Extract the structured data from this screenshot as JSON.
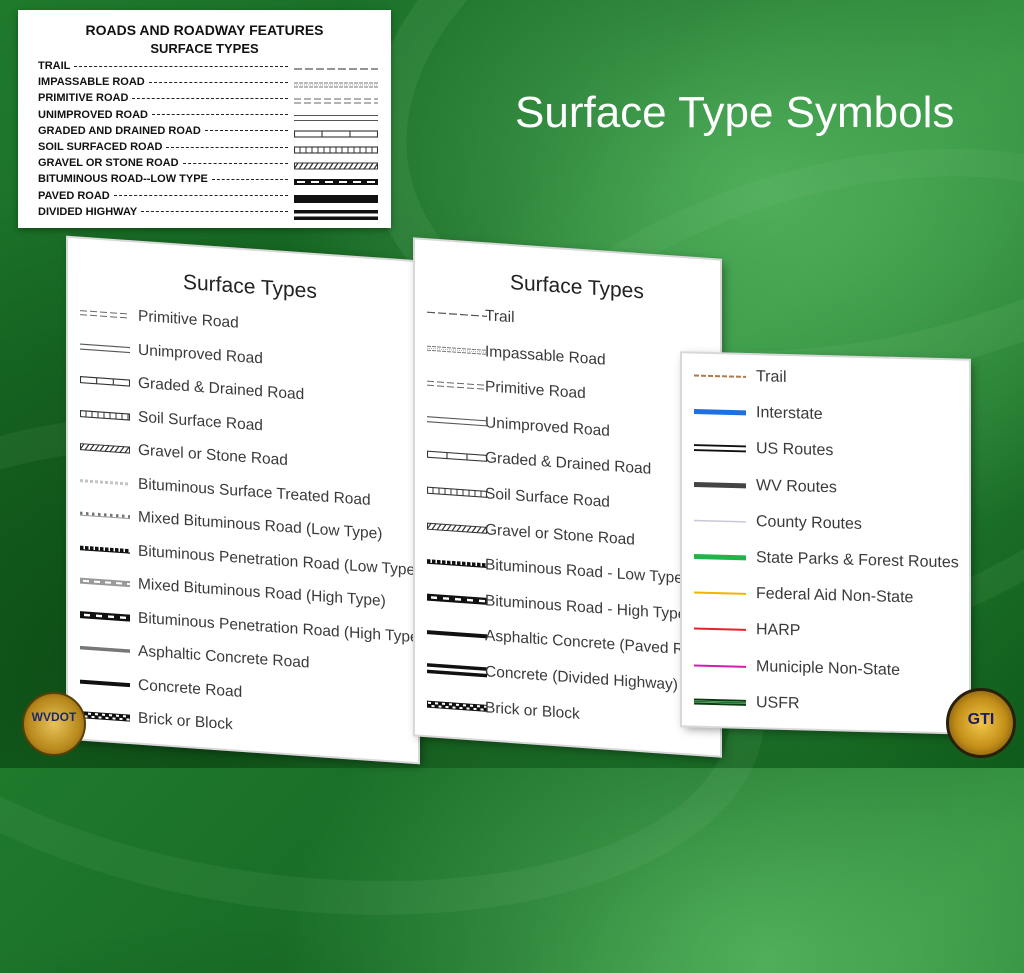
{
  "slide": {
    "title": "Surface Type Symbols"
  },
  "legend_box": {
    "title": "ROADS AND ROADWAY FEATURES",
    "subtitle": "SURFACE TYPES",
    "rows": [
      {
        "label": "TRAIL",
        "symbol": "trail"
      },
      {
        "label": "IMPASSABLE ROAD",
        "symbol": "impassable"
      },
      {
        "label": "PRIMITIVE ROAD",
        "symbol": "primitive"
      },
      {
        "label": "UNIMPROVED ROAD",
        "symbol": "unimproved"
      },
      {
        "label": "GRADED AND DRAINED ROAD",
        "symbol": "graded"
      },
      {
        "label": "SOIL SURFACED ROAD",
        "symbol": "soil"
      },
      {
        "label": "GRAVEL OR STONE ROAD",
        "symbol": "gravel"
      },
      {
        "label": "BITUMINOUS ROAD--LOW TYPE",
        "symbol": "bituminous-low"
      },
      {
        "label": "PAVED ROAD",
        "symbol": "paved"
      },
      {
        "label": "DIVIDED HIGHWAY",
        "symbol": "divided"
      }
    ]
  },
  "panel_left": {
    "title": "Surface Types",
    "items": [
      {
        "label": "Primitive Road",
        "symbol": "primitive"
      },
      {
        "label": "Unimproved Road",
        "symbol": "unimproved"
      },
      {
        "label": "Graded & Drained Road",
        "symbol": "graded"
      },
      {
        "label": "Soil Surface Road",
        "symbol": "soil"
      },
      {
        "label": "Gravel or Stone Road",
        "symbol": "gravel"
      },
      {
        "label": "Bituminous Surface Treated Road",
        "symbol": "bst"
      },
      {
        "label": "Mixed Bituminous Road (Low Type)",
        "symbol": "mixed-low"
      },
      {
        "label": "Bituminous Penetration Road (Low Type)",
        "symbol": "pen-low"
      },
      {
        "label": "Mixed Bituminous Road (High Type)",
        "symbol": "mixed-high"
      },
      {
        "label": "Bituminous Penetration Road (High Type)",
        "symbol": "pen-high"
      },
      {
        "label": "Asphaltic Concrete Road",
        "symbol": "asphalt"
      },
      {
        "label": "Concrete Road",
        "symbol": "concrete"
      },
      {
        "label": "Brick or Block",
        "symbol": "brick"
      }
    ]
  },
  "panel_middle": {
    "title": "Surface Types",
    "items": [
      {
        "label": "Trail",
        "symbol": "trail"
      },
      {
        "label": "Impassable Road",
        "symbol": "impassable"
      },
      {
        "label": "Primitive Road",
        "symbol": "primitive"
      },
      {
        "label": "Unimproved Road",
        "symbol": "unimproved"
      },
      {
        "label": "Graded & Drained Road",
        "symbol": "graded"
      },
      {
        "label": "Soil Surface Road",
        "symbol": "soil"
      },
      {
        "label": "Gravel or Stone Road",
        "symbol": "gravel"
      },
      {
        "label": "Bituminous Road - Low Type",
        "symbol": "pen-low"
      },
      {
        "label": "Bituminous Road - High Type",
        "symbol": "pen-high"
      },
      {
        "label": "Asphaltic Concrete (Paved Road)",
        "symbol": "concrete"
      },
      {
        "label": "Concrete (Divided Highway)",
        "symbol": "divided"
      },
      {
        "label": "Brick or Block",
        "symbol": "brick"
      }
    ]
  },
  "panel_right": {
    "items": [
      {
        "label": "Trail",
        "symbol": "trail-brown",
        "color": "#b07a4a"
      },
      {
        "label": "Interstate",
        "symbol": "solid-thick",
        "color": "#1f6fe0"
      },
      {
        "label": "US Routes",
        "symbol": "double",
        "color": "#111111"
      },
      {
        "label": "WV Routes",
        "symbol": "solid-thick",
        "color": "#444444"
      },
      {
        "label": "County Routes",
        "symbol": "solid-thin",
        "color": "#c8c8d8"
      },
      {
        "label": "State Parks & Forest Routes",
        "symbol": "solid-thick",
        "color": "#1fb54a"
      },
      {
        "label": "Federal Aid Non-State",
        "symbol": "solid-med",
        "color": "#f2b400"
      },
      {
        "label": "HARP",
        "symbol": "solid-med",
        "color": "#e8202a"
      },
      {
        "label": "Municiple Non-State",
        "symbol": "solid-med",
        "color": "#d81bb0"
      },
      {
        "label": "USFR",
        "symbol": "usfr",
        "color": "#1c7a2a"
      }
    ]
  },
  "logos": {
    "left": "WVDOT",
    "right": "GTI"
  }
}
